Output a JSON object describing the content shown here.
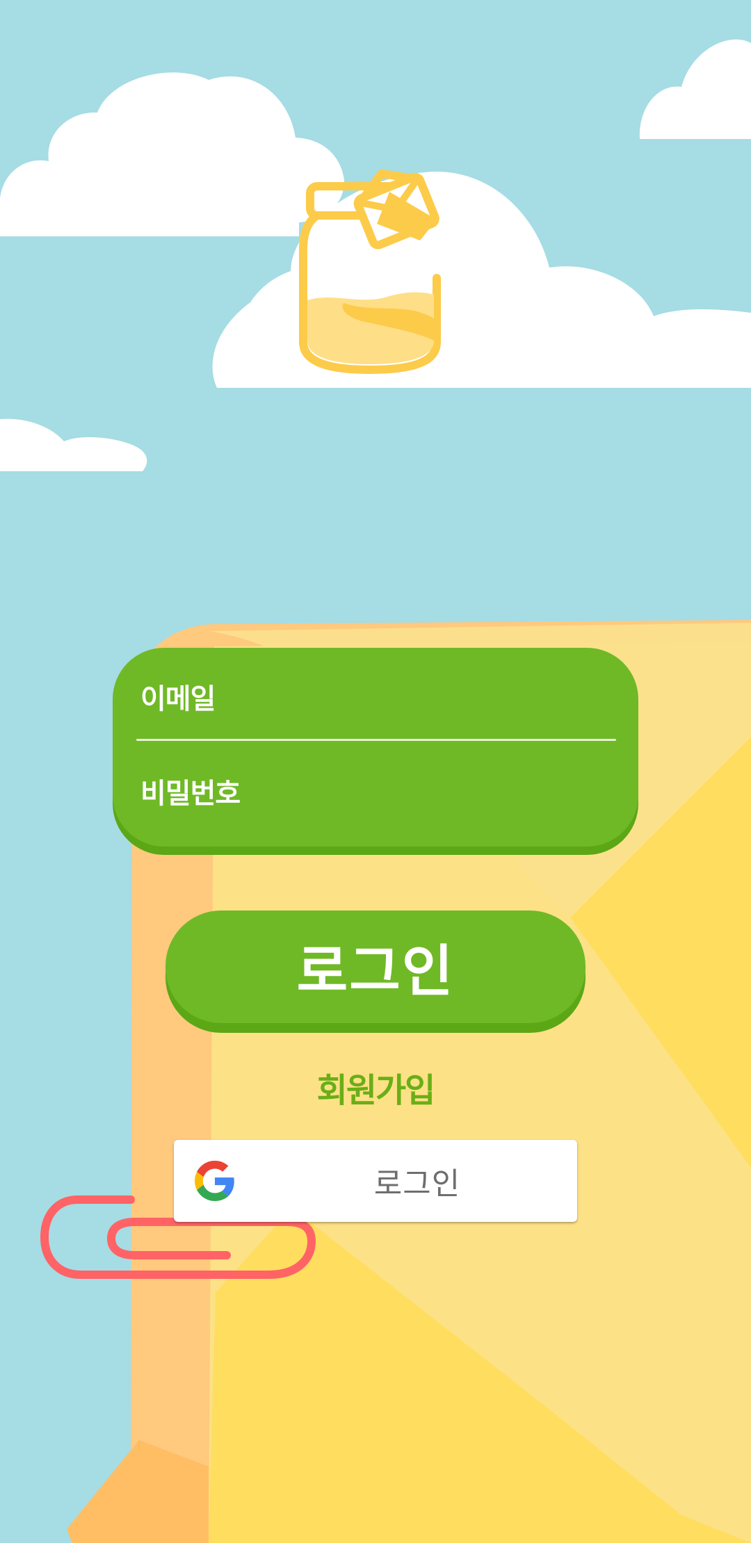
{
  "app": {
    "logo_icon": "jar-icon"
  },
  "login_form": {
    "email_placeholder": "이메일",
    "password_placeholder": "비밀번호"
  },
  "actions": {
    "login_label": "로그인",
    "signup_label": "회원가입",
    "google_login_label": "로그인",
    "google_icon": "google-icon"
  },
  "colors": {
    "sky": "#A6DCE4",
    "primary_green": "#6FB926",
    "primary_green_shadow": "#5BA715",
    "signup_text": "#6AAE17",
    "envelope_yellow": "#FCE186",
    "jar_yellow": "#FDCB4A",
    "paper_clip": "#FF6366"
  }
}
